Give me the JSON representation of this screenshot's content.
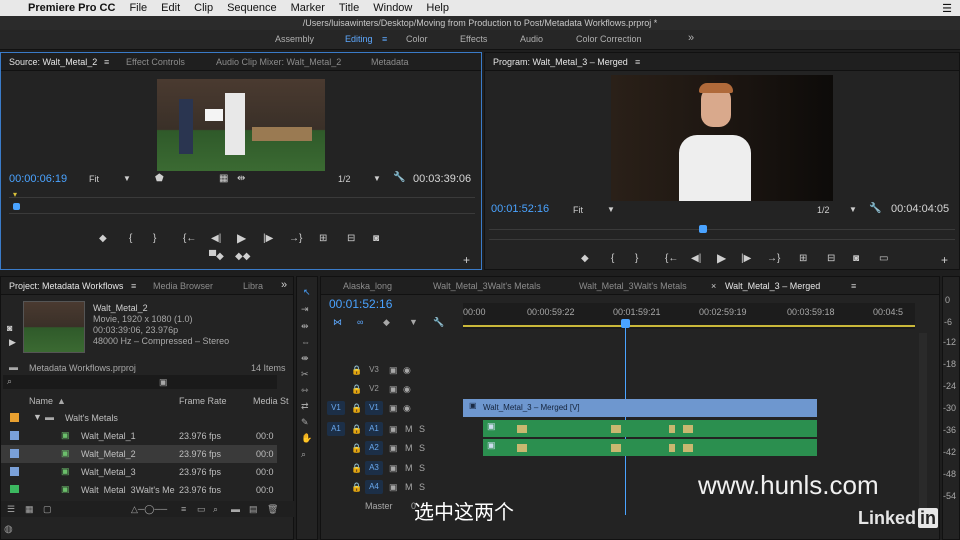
{
  "menubar": {
    "app": "Premiere Pro CC",
    "items": [
      "File",
      "Edit",
      "Clip",
      "Sequence",
      "Marker",
      "Title",
      "Window",
      "Help"
    ]
  },
  "titlebar": {
    "path": "/Users/luisawinters/Desktop/Moving from Production to Post/Metadata Workflows.prproj *"
  },
  "workspaces": [
    "Assembly",
    "Editing",
    "Color",
    "Effects",
    "Audio",
    "Color Correction"
  ],
  "source": {
    "tabs": [
      "Source: Walt_Metal_2",
      "Effect Controls",
      "Audio Clip Mixer: Walt_Metal_2",
      "Metadata"
    ],
    "timecode": "00:00:06:19",
    "fit": "Fit",
    "resolution": "1/2",
    "duration": "00:03:39:06"
  },
  "program": {
    "tab": "Program: Walt_Metal_3 – Merged",
    "timecode": "00:01:52:16",
    "fit": "Fit",
    "resolution": "1/2",
    "duration": "00:04:04:05"
  },
  "project": {
    "tabs": [
      "Project: Metadata Workflows",
      "Media Browser",
      "Libra"
    ],
    "clip_name": "Walt_Metal_2",
    "clip_info1": "Movie, 1920 x 1080 (1.0)",
    "clip_info2": "00:03:39:06, 23.976p",
    "clip_info3": "48000 Hz – Compressed – Stereo",
    "file": "Metadata Workflows.prproj",
    "items_count": "14 Items",
    "columns": [
      "Name",
      "Frame Rate",
      "Media St"
    ],
    "rows": [
      {
        "name": "Walt's Metals",
        "rate": "",
        "start": "",
        "color": "#e8a030"
      },
      {
        "name": "Walt_Metal_1",
        "rate": "23.976 fps",
        "start": "00:0",
        "color": "#7aa0d8"
      },
      {
        "name": "Walt_Metal_2",
        "rate": "23.976 fps",
        "start": "00:0",
        "color": "#7aa0d8"
      },
      {
        "name": "Walt_Metal_3",
        "rate": "23.976 fps",
        "start": "00:0",
        "color": "#7aa0d8"
      },
      {
        "name": "Walt_Metal_3Walt's Me",
        "rate": "23.976 fps",
        "start": "00:0",
        "color": "#3cb860"
      }
    ]
  },
  "timeline": {
    "tabs": [
      "Alaska_long",
      "Walt_Metal_3Walt's Metals",
      "Walt_Metal_3Walt's Metals",
      "Walt_Metal_3 – Merged"
    ],
    "timecode": "00:01:52:16",
    "ruler": [
      "00:00",
      "00:00:59:22",
      "00:01:59:21",
      "00:02:59:19",
      "00:03:59:18",
      "00:04:5"
    ],
    "video_tracks": [
      "V3",
      "V2",
      "V1"
    ],
    "audio_tracks": [
      "A1",
      "A2",
      "A3",
      "A4"
    ],
    "master": "Master",
    "master_val": "0",
    "src_v": "V1",
    "src_a": "A1",
    "clip_label": "Walt_Metal_3 – Merged [V]",
    "m_label": "M",
    "s_label": "S"
  },
  "meter": [
    "0",
    "-6",
    "-12",
    "-18",
    "-24",
    "-30",
    "-36",
    "-42",
    "-48",
    "-54"
  ],
  "subtitle": "选中这两个",
  "watermark": "www.hunls.com",
  "linkedin": "Linked",
  "linkedin_in": "in"
}
